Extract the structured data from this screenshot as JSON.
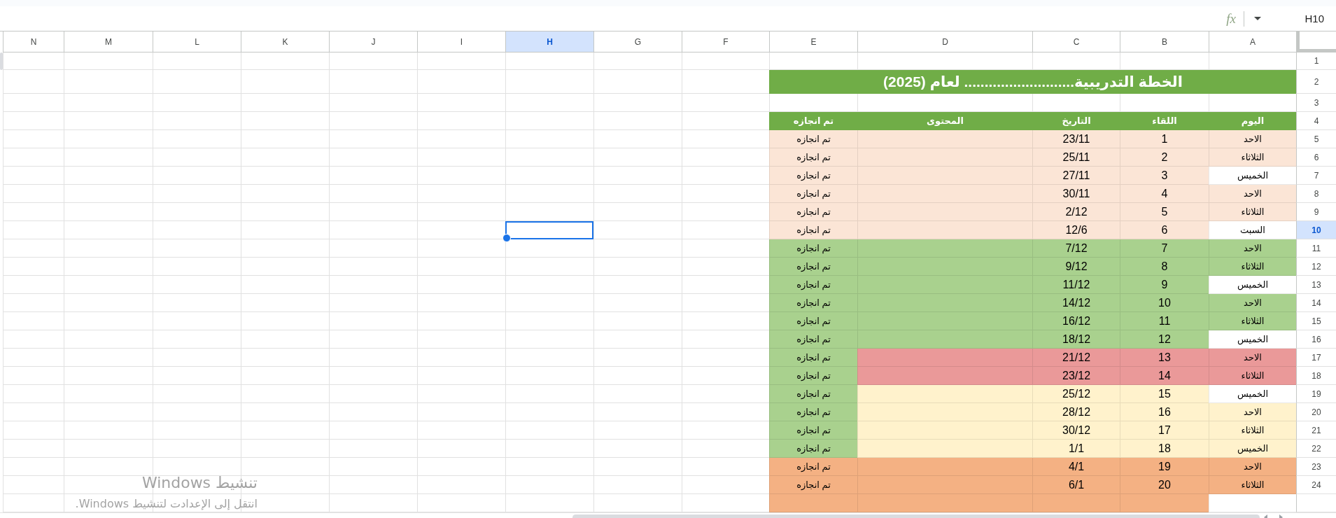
{
  "formula_bar": {
    "name_box": "H10",
    "function_label": "fx"
  },
  "sheet": {
    "columns": [
      {
        "label": "A",
        "selected": false
      },
      {
        "label": "B",
        "selected": false
      },
      {
        "label": "C",
        "selected": false
      },
      {
        "label": "D",
        "selected": false
      },
      {
        "label": "E",
        "selected": false
      },
      {
        "label": "F",
        "selected": false
      },
      {
        "label": "G",
        "selected": false
      },
      {
        "label": "H",
        "selected": true
      },
      {
        "label": "I",
        "selected": false
      },
      {
        "label": "J",
        "selected": false
      },
      {
        "label": "K",
        "selected": false
      },
      {
        "label": "L",
        "selected": false
      },
      {
        "label": "M",
        "selected": false
      },
      {
        "label": "N",
        "selected": false
      }
    ],
    "rows": [
      {
        "number": "1",
        "selected": false,
        "kind": "blank"
      },
      {
        "number": "2",
        "selected": false,
        "kind": "title",
        "text": "الخطة التدريبية........................... لعام (2025)"
      },
      {
        "number": "3",
        "selected": false,
        "kind": "blank"
      },
      {
        "number": "4",
        "selected": false,
        "kind": "header",
        "cells": [
          "اليوم",
          "اللقاء",
          "التاريخ",
          "المحتوى",
          "تم انجازه"
        ]
      },
      {
        "number": "5",
        "selected": false,
        "kind": "data",
        "cells": [
          {
            "text": "الاحد",
            "color": "#fbe5d6"
          },
          {
            "text": "1",
            "color": "#fbe5d6"
          },
          {
            "text": "23/11",
            "color": "#fbe5d6"
          },
          {
            "color": "#fbe5d6"
          },
          {
            "text": "تم انجازه",
            "color": "#fbe5d6"
          }
        ]
      },
      {
        "number": "6",
        "selected": false,
        "kind": "data",
        "cells": [
          {
            "text": "الثلاثاء",
            "color": "#fbe5d6"
          },
          {
            "text": "2",
            "color": "#fbe5d6"
          },
          {
            "text": "25/11",
            "color": "#fbe5d6"
          },
          {
            "color": "#fbe5d6"
          },
          {
            "text": "تم انجازه",
            "color": "#fbe5d6"
          }
        ]
      },
      {
        "number": "7",
        "selected": false,
        "kind": "data",
        "cells": [
          {
            "text": "الخميس",
            "color": "#ffffff"
          },
          {
            "text": "3",
            "color": "#fbe5d6"
          },
          {
            "text": "27/11",
            "color": "#fbe5d6"
          },
          {
            "color": "#fbe5d6"
          },
          {
            "text": "تم انجازه",
            "color": "#fbe5d6"
          }
        ]
      },
      {
        "number": "8",
        "selected": false,
        "kind": "data",
        "cells": [
          {
            "text": "الاحد",
            "color": "#fbe5d6"
          },
          {
            "text": "4",
            "color": "#fbe5d6"
          },
          {
            "text": "30/11",
            "color": "#fbe5d6"
          },
          {
            "color": "#fbe5d6"
          },
          {
            "text": "تم انجازه",
            "color": "#fbe5d6"
          }
        ]
      },
      {
        "number": "9",
        "selected": false,
        "kind": "data",
        "cells": [
          {
            "text": "الثلاثاء",
            "color": "#fbe5d6"
          },
          {
            "text": "5",
            "color": "#fbe5d6"
          },
          {
            "text": "2/12",
            "color": "#fbe5d6"
          },
          {
            "color": "#fbe5d6"
          },
          {
            "text": "تم انجازه",
            "color": "#fbe5d6"
          }
        ]
      },
      {
        "number": "10",
        "selected": true,
        "kind": "data",
        "cells": [
          {
            "text": "السبت",
            "color": "#ffffff"
          },
          {
            "text": "6",
            "color": "#fbe5d6"
          },
          {
            "text": "12/6",
            "color": "#fbe5d6"
          },
          {
            "color": "#fbe5d6"
          },
          {
            "text": "تم انجازه",
            "color": "#fbe5d6"
          }
        ]
      },
      {
        "number": "11",
        "selected": false,
        "kind": "data",
        "cells": [
          {
            "text": "الاحد",
            "color": "#a9d18e"
          },
          {
            "text": "7",
            "color": "#a9d18e"
          },
          {
            "text": "7/12",
            "color": "#a9d18e"
          },
          {
            "color": "#a9d18e"
          },
          {
            "text": "تم انجازه",
            "color": "#a9d18e"
          }
        ]
      },
      {
        "number": "12",
        "selected": false,
        "kind": "data",
        "cells": [
          {
            "text": "الثلاثاء",
            "color": "#a9d18e"
          },
          {
            "text": "8",
            "color": "#a9d18e"
          },
          {
            "text": "9/12",
            "color": "#a9d18e"
          },
          {
            "color": "#a9d18e"
          },
          {
            "text": "تم انجازه",
            "color": "#a9d18e"
          }
        ]
      },
      {
        "number": "13",
        "selected": false,
        "kind": "data",
        "cells": [
          {
            "text": "الخميس",
            "color": "#ffffff"
          },
          {
            "text": "9",
            "color": "#a9d18e"
          },
          {
            "text": "11/12",
            "color": "#a9d18e"
          },
          {
            "color": "#a9d18e"
          },
          {
            "text": "تم انجازه",
            "color": "#a9d18e"
          }
        ]
      },
      {
        "number": "14",
        "selected": false,
        "kind": "data",
        "cells": [
          {
            "text": "الاحد",
            "color": "#a9d18e"
          },
          {
            "text": "10",
            "color": "#a9d18e"
          },
          {
            "text": "14/12",
            "color": "#a9d18e"
          },
          {
            "color": "#a9d18e"
          },
          {
            "text": "تم انجازه",
            "color": "#a9d18e"
          }
        ]
      },
      {
        "number": "15",
        "selected": false,
        "kind": "data",
        "cells": [
          {
            "text": "الثلاثاء",
            "color": "#a9d18e"
          },
          {
            "text": "11",
            "color": "#a9d18e"
          },
          {
            "text": "16/12",
            "color": "#a9d18e"
          },
          {
            "color": "#a9d18e"
          },
          {
            "text": "تم انجازه",
            "color": "#a9d18e"
          }
        ]
      },
      {
        "number": "16",
        "selected": false,
        "kind": "data",
        "cells": [
          {
            "text": "الخميس",
            "color": "#ffffff"
          },
          {
            "text": "12",
            "color": "#a9d18e"
          },
          {
            "text": "18/12",
            "color": "#a9d18e"
          },
          {
            "color": "#a9d18e"
          },
          {
            "text": "تم انجازه",
            "color": "#a9d18e"
          }
        ]
      },
      {
        "number": "17",
        "selected": false,
        "kind": "data",
        "cells": [
          {
            "text": "الاحد",
            "color": "#ea9999"
          },
          {
            "text": "13",
            "color": "#ea9999"
          },
          {
            "text": "21/12",
            "color": "#ea9999"
          },
          {
            "color": "#ea9999"
          },
          {
            "text": "تم انجازه",
            "color": "#a9d18e"
          }
        ]
      },
      {
        "number": "18",
        "selected": false,
        "kind": "data",
        "cells": [
          {
            "text": "الثلاثاء",
            "color": "#ea9999"
          },
          {
            "text": "14",
            "color": "#ea9999"
          },
          {
            "text": "23/12",
            "color": "#ea9999"
          },
          {
            "color": "#ea9999"
          },
          {
            "text": "تم انجازه",
            "color": "#a9d18e"
          }
        ]
      },
      {
        "number": "19",
        "selected": false,
        "kind": "data",
        "cells": [
          {
            "text": "الخميس",
            "color": "#ffffff"
          },
          {
            "text": "15",
            "color": "#fff2cc"
          },
          {
            "text": "25/12",
            "color": "#fff2cc"
          },
          {
            "color": "#fff2cc"
          },
          {
            "text": "تم انجازه",
            "color": "#a9d18e"
          }
        ]
      },
      {
        "number": "20",
        "selected": false,
        "kind": "data",
        "cells": [
          {
            "text": "الاحد",
            "color": "#fff2cc"
          },
          {
            "text": "16",
            "color": "#fff2cc"
          },
          {
            "text": "28/12",
            "color": "#fff2cc"
          },
          {
            "color": "#fff2cc"
          },
          {
            "text": "تم انجازه",
            "color": "#a9d18e"
          }
        ]
      },
      {
        "number": "21",
        "selected": false,
        "kind": "data",
        "cells": [
          {
            "text": "الثلاثاء",
            "color": "#fff2cc"
          },
          {
            "text": "17",
            "color": "#fff2cc"
          },
          {
            "text": "30/12",
            "color": "#fff2cc"
          },
          {
            "color": "#fff2cc"
          },
          {
            "text": "تم انجازه",
            "color": "#a9d18e"
          }
        ]
      },
      {
        "number": "22",
        "selected": false,
        "kind": "data",
        "cells": [
          {
            "text": "الخميس",
            "color": "#fff2cc"
          },
          {
            "text": "18",
            "color": "#fff2cc"
          },
          {
            "text": "1/1",
            "color": "#fff2cc"
          },
          {
            "color": "#fff2cc"
          },
          {
            "text": "تم انجازه",
            "color": "#a9d18e"
          }
        ]
      },
      {
        "number": "23",
        "selected": false,
        "kind": "data",
        "cells": [
          {
            "text": "الاحد",
            "color": "#f4b183"
          },
          {
            "text": "19",
            "color": "#f4b183"
          },
          {
            "text": "4/1",
            "color": "#f4b183"
          },
          {
            "color": "#f4b183"
          },
          {
            "text": "تم انجازه",
            "color": "#f4b183"
          }
        ]
      },
      {
        "number": "24",
        "selected": false,
        "kind": "data",
        "cells": [
          {
            "text": "الثلاثاء",
            "color": "#f4b183"
          },
          {
            "text": "20",
            "color": "#f4b183"
          },
          {
            "text": "6/1",
            "color": "#f4b183"
          },
          {
            "color": "#f4b183"
          },
          {
            "text": "تم انجازه",
            "color": "#f4b183"
          }
        ]
      },
      {
        "selected": false,
        "kind": "data",
        "cells": [
          {
            "color": "#ffffff"
          },
          {
            "color": "#f4b183"
          },
          {
            "color": "#f4b183"
          },
          {
            "color": "#f4b183"
          },
          {
            "color": "#f4b183"
          }
        ]
      }
    ]
  },
  "activation_notice": {
    "title": "تنشيط Windows",
    "message": "انتقل إلى الإعدادت لتنشيط Windows."
  }
}
